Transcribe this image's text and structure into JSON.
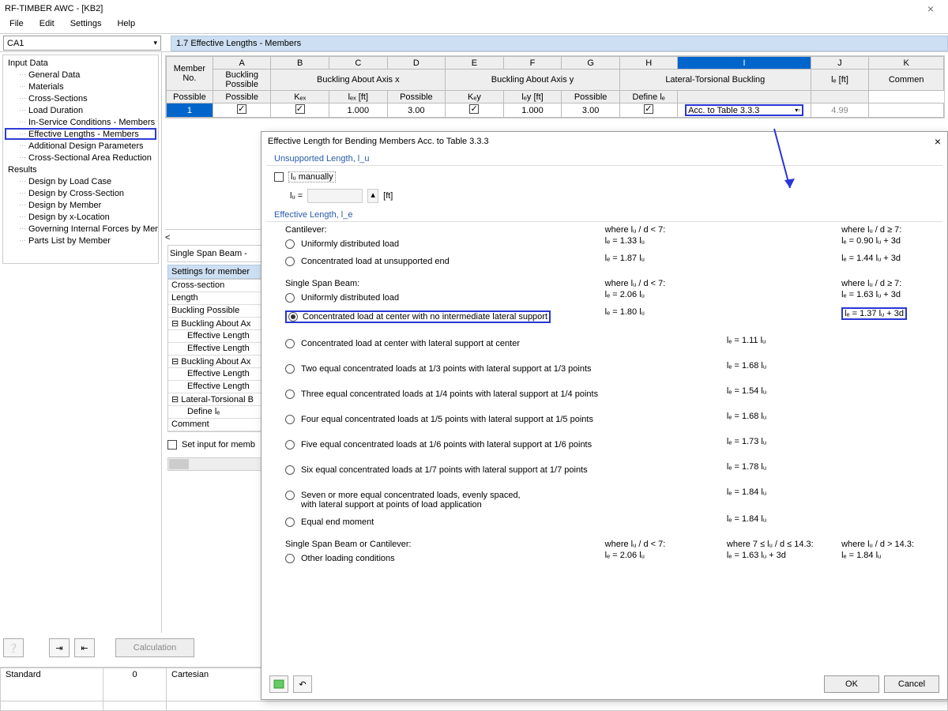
{
  "window": {
    "title": "RF-TIMBER AWC - [KB2]",
    "close": "×"
  },
  "menu": {
    "file": "File",
    "edit": "Edit",
    "settings": "Settings",
    "help": "Help"
  },
  "loadcase": {
    "name": "CA1"
  },
  "panelTitle": "1.7 Effective Lengths - Members",
  "cols": {
    "A": "A",
    "B": "B",
    "C": "C",
    "D": "D",
    "E": "E",
    "F": "F",
    "G": "G",
    "H": "H",
    "I": "I",
    "J": "J",
    "K": "K"
  },
  "hdr": {
    "memberNo": "Member No.",
    "bucklingPossible": "Buckling Possible",
    "bax": "Buckling About Axis x",
    "bay": "Buckling About Axis y",
    "ltb": "Lateral-Torsional Buckling",
    "possible": "Possible",
    "kex": "Kₑₓ",
    "lex": "lₑₓ [ft]",
    "key": "Kₑy",
    "ley": "lₑy [ft]",
    "definele": "Define lₑ",
    "lef": "lₑ [ft]",
    "comment": "Commen"
  },
  "row": {
    "no": "1",
    "kex": "1.000",
    "lex": "3.00",
    "key": "1.000",
    "ley": "3.00",
    "define": "Acc. to Table 3.3.3",
    "lef": "4.99"
  },
  "tree": {
    "input": "Input Data",
    "items1": [
      "General Data",
      "Materials",
      "Cross-Sections",
      "Load Duration",
      "In-Service Conditions - Members",
      "Effective Lengths - Members",
      "Additional Design Parameters",
      "Cross-Sectional Area Reduction"
    ],
    "results": "Results",
    "items2": [
      "Design by Load Case",
      "Design by Cross-Section",
      "Design by Member",
      "Design by x-Location",
      "Governing Internal Forces by Member",
      "Parts List by Member"
    ]
  },
  "below": "Single Span Beam -",
  "settingsTitle": "Settings for member",
  "settings": [
    "Cross-section",
    "Length",
    "Buckling Possible",
    "Buckling About Ax",
    "Effective Length",
    "Effective Length",
    "Buckling About Ax",
    "Effective Length",
    "Effective Length",
    "Lateral-Torsional B",
    "Define lₑ",
    "Comment"
  ],
  "setinput": "Set input for memb",
  "calc": "Calculation",
  "status": {
    "standard": "Standard",
    "zero": "0",
    "cartesian": "Cartesian"
  },
  "dialog": {
    "title": "Effective Length for Bending Members Acc. to Table 3.3.3",
    "sec1": "Unsupported Length, l_u",
    "lu_manual": "lᵤ manually",
    "lu": "lᵤ =",
    "ft": "[ft]",
    "sec2": "Effective Length, l_e",
    "cantilever": "Cantilever:",
    "where1": "where lᵤ / d < 7:",
    "where2": "where lᵤ / d ≥ 7:",
    "where3": "where 7 ≤ lᵤ / d  ≤ 14.3:",
    "where4": "where lᵤ / d > 14.3:",
    "c1": "Uniformly distributed load",
    "c1a": "lₑ = 1.33 lᵤ",
    "c1b": "lₑ = 0.90 lᵤ + 3d",
    "c2": "Concentrated load at unsupported end",
    "c2a": "lₑ = 1.87 lᵤ",
    "c2b": "lₑ = 1.44 lᵤ + 3d",
    "ssb": "Single Span Beam:",
    "s1": "Uniformly distributed load",
    "s1a": "lₑ = 2.06 lᵤ",
    "s1b": "lₑ = 1.63 lᵤ + 3d",
    "s2": "Concentrated load at center with no intermediate lateral support",
    "s2a": "lₑ = 1.80 lᵤ",
    "s2b": "lₑ = 1.37 lᵤ + 3d",
    "s3": "Concentrated load at center with lateral support at center",
    "s3a": "lₑ = 1.11 lᵤ",
    "s4": "Two equal concentrated loads at 1/3 points with lateral support at 1/3 points",
    "s4a": "lₑ = 1.68 lᵤ",
    "s5": "Three equal concentrated loads at 1/4 points with lateral support at 1/4 points",
    "s5a": "lₑ = 1.54 lᵤ",
    "s6": "Four equal concentrated loads at 1/5 points with lateral support at 1/5 points",
    "s6a": "lₑ = 1.68 lᵤ",
    "s7": "Five equal concentrated loads at 1/6 points with lateral support at 1/6 points",
    "s7a": "lₑ = 1.73 lᵤ",
    "s8": "Six equal concentrated loads at 1/7 points with lateral support at 1/7 points",
    "s8a": "lₑ = 1.78 lᵤ",
    "s9a": "Seven or more equal concentrated loads, evenly spaced,",
    "s9b": "with lateral support at points of load application",
    "s9v": "lₑ = 1.84 lᵤ",
    "s10": "Equal end moment",
    "s10a": "lₑ = 1.84 lᵤ",
    "combo": "Single Span Beam or Cantilever:",
    "oth": "Other loading conditions",
    "otha": "lₑ = 2.06 lᵤ",
    "othb": "lₑ = 1.63 lᵤ + 3d",
    "othc": "lₑ = 1.84 lᵤ",
    "ok": "OK",
    "cancel": "Cancel"
  }
}
